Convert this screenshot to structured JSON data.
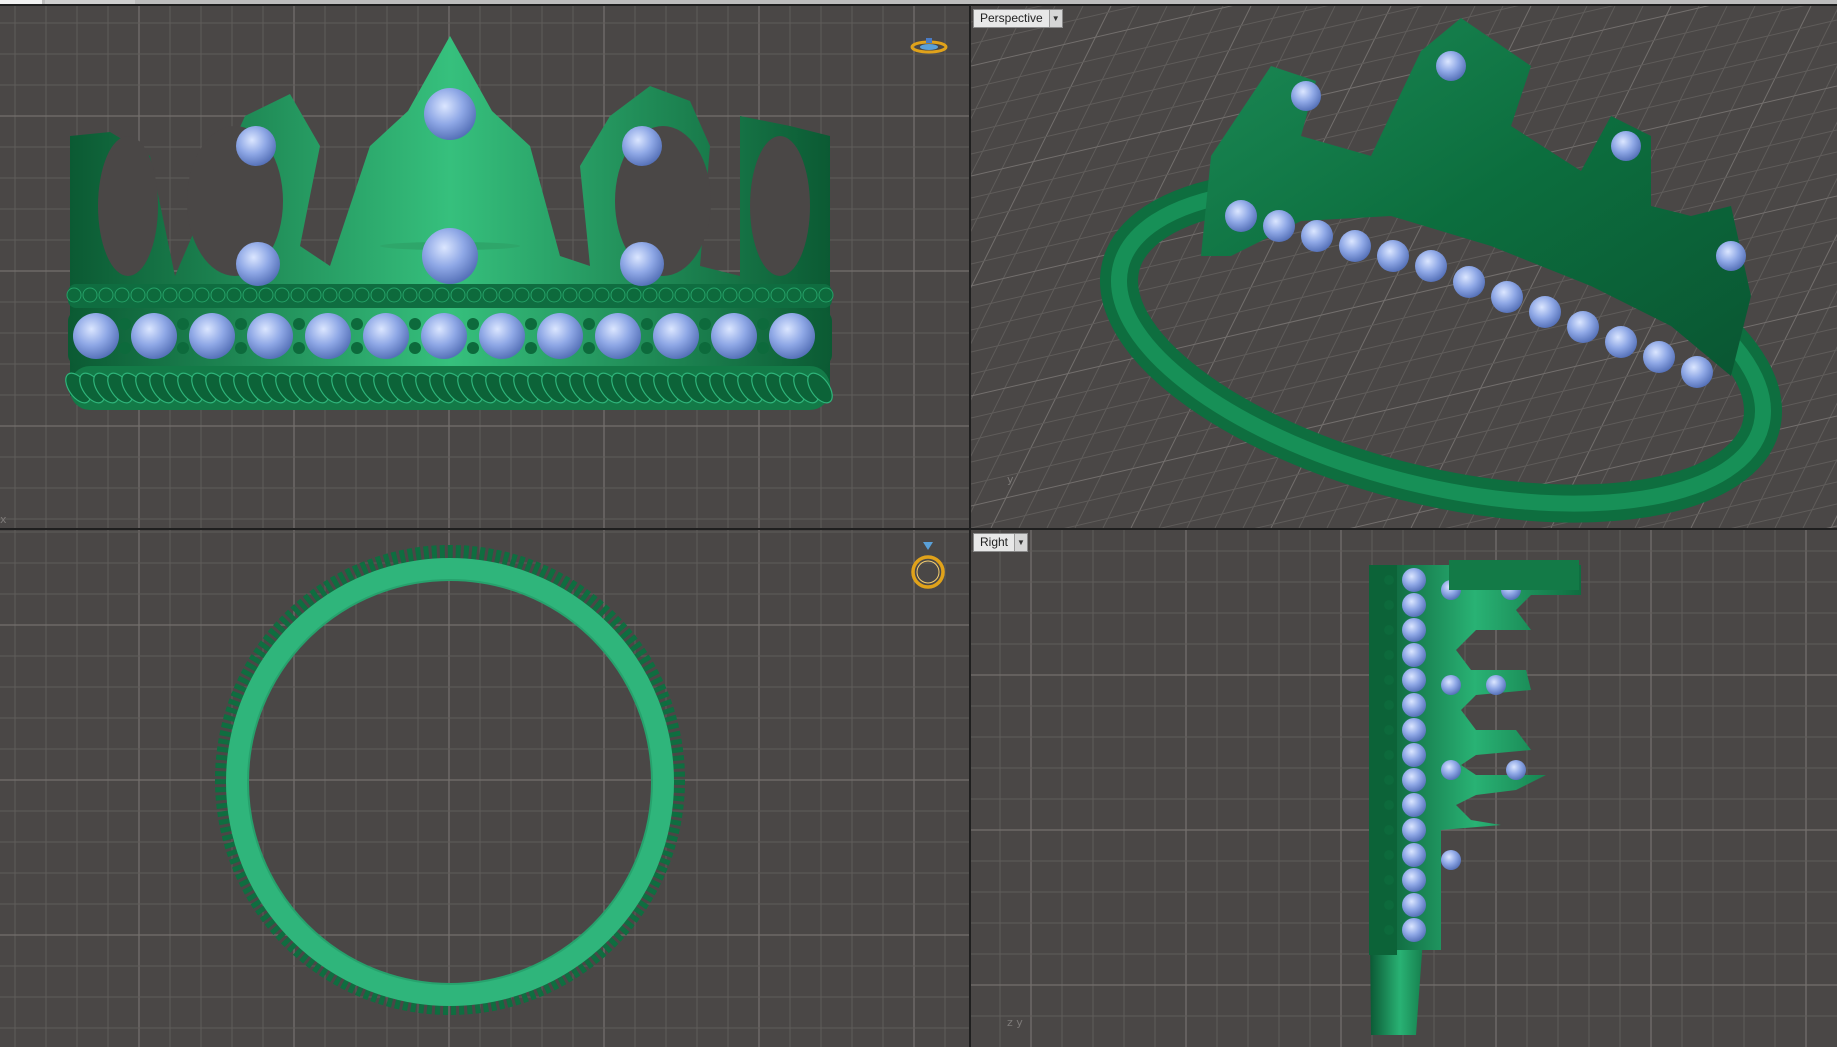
{
  "app": {
    "toolbar_hint": "",
    "colors": {
      "viewport_bg": "#4a4746",
      "grid_minor": "#5f5c5a",
      "grid_major": "#736f6d",
      "model_green": "#1f9a5e",
      "model_dark": "#0b5a33",
      "gem_blue": "#8fa8e6",
      "gumball": "#e0a21a",
      "separator": "#9a9a9a"
    }
  },
  "viewports": {
    "front": {
      "label": "",
      "icon": "ring-front-gumball-icon"
    },
    "perspective": {
      "label": "Perspective",
      "dropdown_icon": "dropdown-arrow-icon"
    },
    "top": {
      "label": "",
      "icon": "ring-top-gumball-icon"
    },
    "right": {
      "label": "Right",
      "dropdown_icon": "dropdown-arrow-icon"
    }
  },
  "axes": {
    "front": "x",
    "perspective": "y",
    "right": "z  y"
  }
}
